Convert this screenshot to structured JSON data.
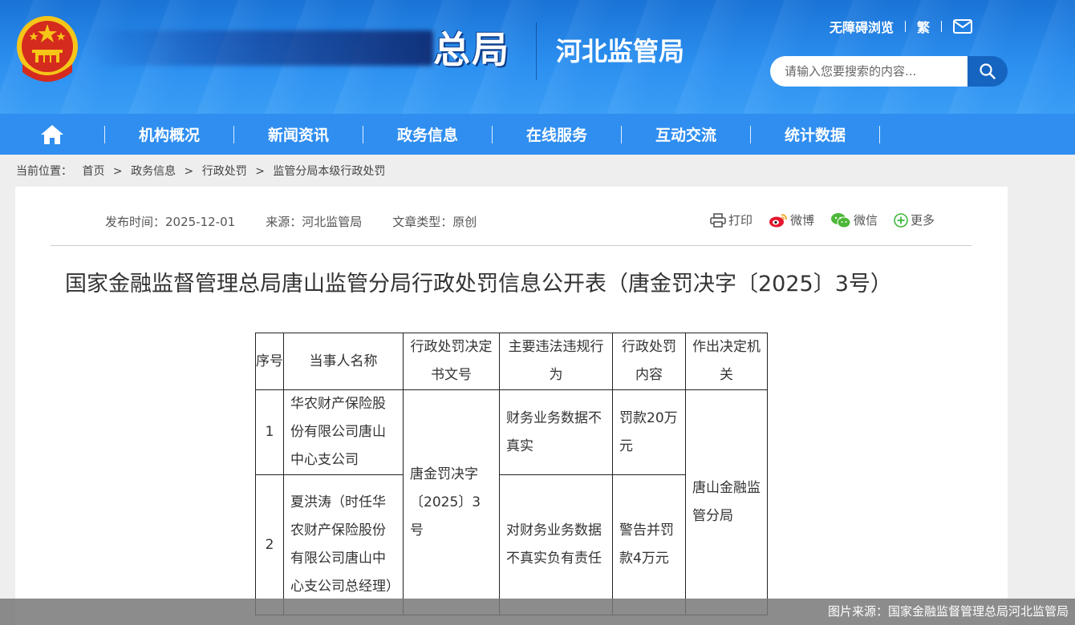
{
  "header": {
    "brand_main": "总局",
    "brand_sub": "河北监管局",
    "links": [
      "无障碍浏览",
      "繁"
    ],
    "search_placeholder": "请输入您要搜索的内容..."
  },
  "nav": {
    "items": [
      "机构概况",
      "新闻资讯",
      "政务信息",
      "在线服务",
      "互动交流",
      "统计数据"
    ]
  },
  "breadcrumb": {
    "label": "当前位置：",
    "items": [
      "首页",
      "政务信息",
      "行政处罚",
      "监管分局本级行政处罚"
    ]
  },
  "article": {
    "publish_time": "发布时间：2025-12-01",
    "source": "来源：河北监管局",
    "type": "文章类型：原创",
    "tools": [
      "打印",
      "微博",
      "微信",
      "更多"
    ],
    "title": "国家金融监督管理总局唐山监管分局行政处罚信息公开表（唐金罚决字〔2025〕3号）"
  },
  "table": {
    "headers": [
      "序号",
      "当事人名称",
      "行政处罚决定书文号",
      "主要违法违规行为",
      "行政处罚内容",
      "作出决定机关"
    ],
    "rows": [
      {
        "index": "1",
        "party": "华农财产保险股份有限公司唐山中心支公司",
        "violation": "财务业务数据不真实",
        "penalty": "罚款20万元"
      },
      {
        "index": "2",
        "party": "夏洪涛（时任华农财产保险股份有限公司唐山中心支公司总经理）",
        "violation": "对财务业务数据不真实负有责任",
        "penalty": "警告并罚款4万元"
      }
    ],
    "decision_no": "唐金罚决字〔2025〕3号",
    "authority": "唐山金融监管分局"
  },
  "caption": "图片来源：国家金融监督管理总局河北监管局",
  "colors": {
    "header_blue": "#2b8ff0",
    "nav_blue": "#2f8ef0",
    "search_button": "#1565c0",
    "emblem_red": "#d52b1e",
    "emblem_gold": "#f5c518"
  }
}
